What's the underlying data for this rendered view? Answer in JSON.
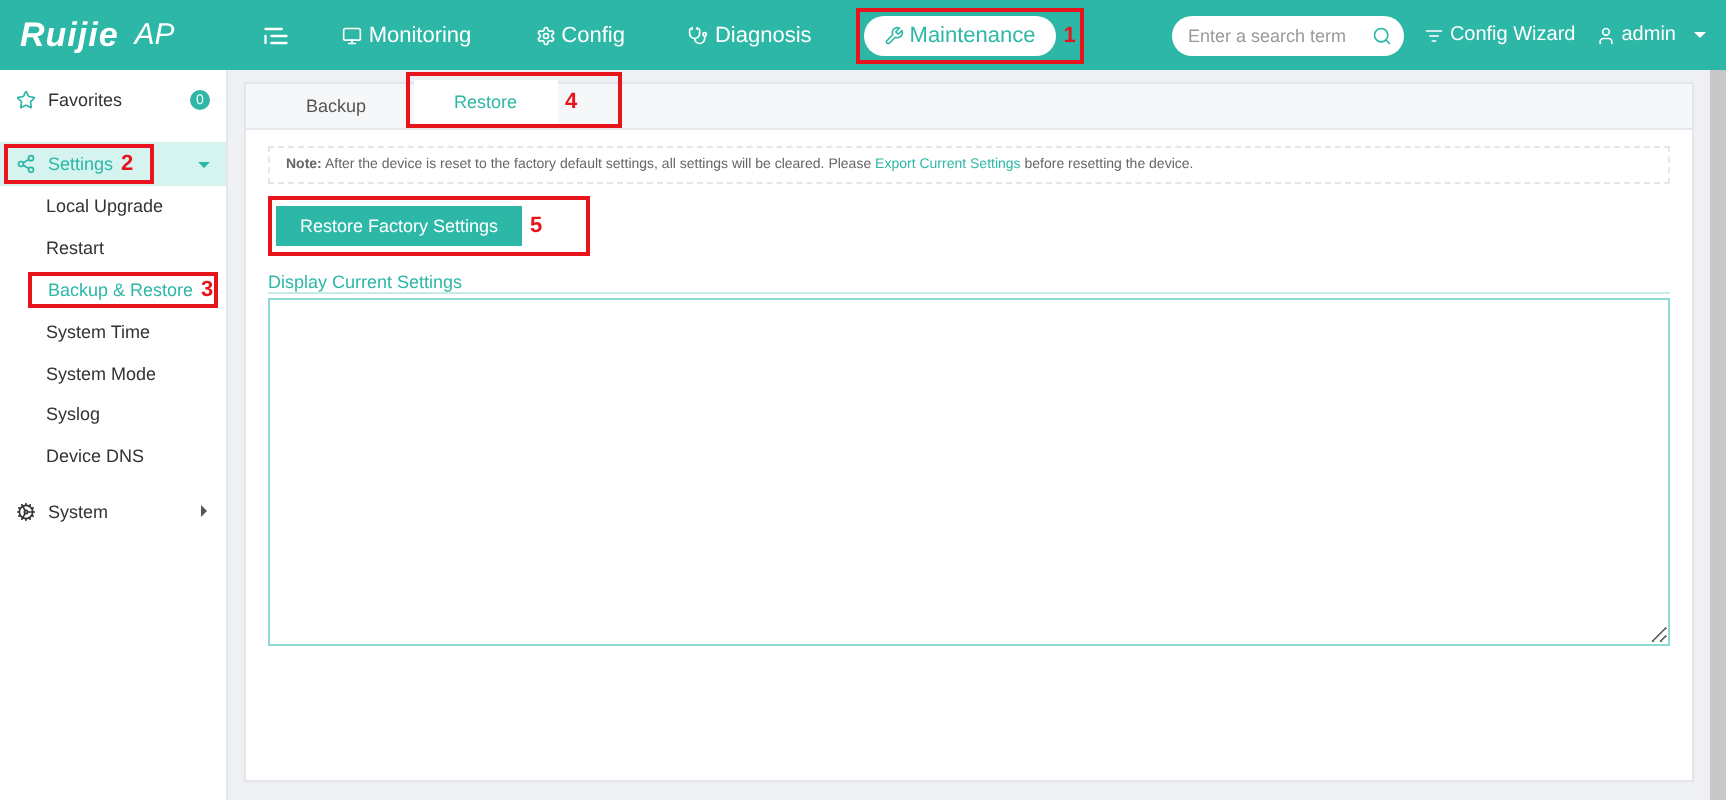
{
  "header": {
    "logo": "Ruijie",
    "product": "AP",
    "nav": [
      {
        "label": "Monitoring",
        "selected": false
      },
      {
        "label": "Config",
        "selected": false
      },
      {
        "label": "Diagnosis",
        "selected": false
      },
      {
        "label": "Maintenance",
        "selected": true,
        "callout": "1"
      }
    ],
    "search": {
      "placeholder": "Enter a search term"
    },
    "wizard": "Config Wizard",
    "user": "admin"
  },
  "sidebar": {
    "favorites": {
      "label": "Favorites",
      "count": "0"
    },
    "groups": [
      {
        "label": "Settings",
        "expanded": true,
        "callout": "2",
        "children": [
          {
            "label": "Local Upgrade",
            "selected": false
          },
          {
            "label": "Restart",
            "selected": false
          },
          {
            "label": "Backup & Restore",
            "selected": true,
            "callout": "3"
          },
          {
            "label": "System Time",
            "selected": false
          },
          {
            "label": "System Mode",
            "selected": false
          },
          {
            "label": "Syslog",
            "selected": false
          },
          {
            "label": "Device DNS",
            "selected": false
          }
        ]
      },
      {
        "label": "System",
        "expanded": false
      }
    ]
  },
  "tabs": [
    {
      "label": "Backup",
      "selected": false
    },
    {
      "label": "Restore",
      "selected": true,
      "callout": "4"
    }
  ],
  "note": {
    "label": "Note:",
    "text": "After the device is reset to the factory default settings, all settings will be cleared. Please",
    "link": "Export Current Settings",
    "after": "before resetting the device."
  },
  "restore_button": {
    "label": "Restore Factory Settings",
    "callout": "5"
  },
  "settings_box": {
    "label": "Display Current Settings"
  }
}
